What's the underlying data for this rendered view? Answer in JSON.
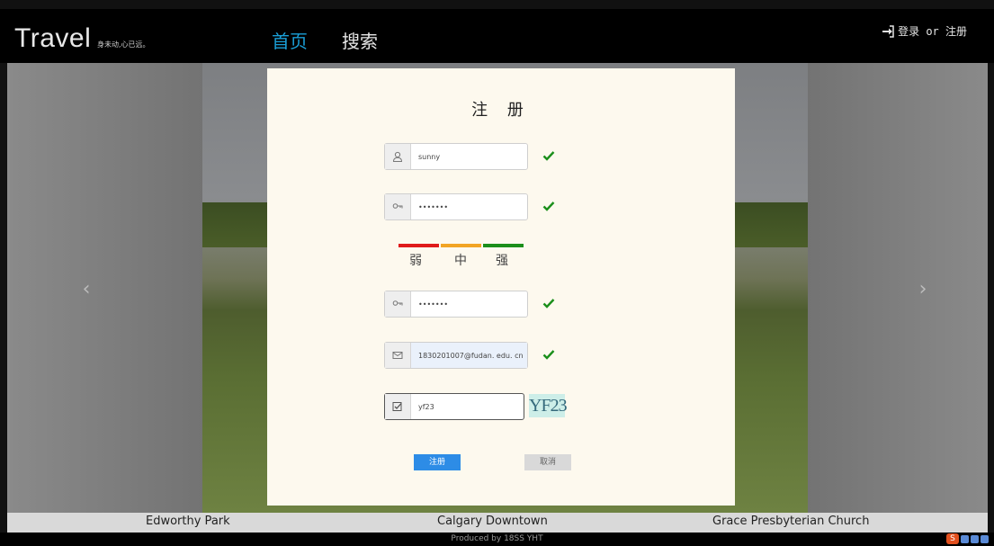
{
  "header": {
    "logo": "Travel",
    "slogan": "身未动,心已远。",
    "nav_home": "首页",
    "nav_search": "搜索",
    "login_text": "登录 or 注册"
  },
  "carousel": {
    "prev_arrow": "‹",
    "next_arrow": "›",
    "captions": [
      "Edworthy Park",
      "Calgary Downtown",
      "Grace Presbyterian Church"
    ]
  },
  "footer": {
    "text": "Produced by 18SS YHT"
  },
  "register": {
    "title": "注 册",
    "username_value": "sunny",
    "password_value": "•••••••",
    "strength_labels": [
      "弱",
      "中",
      "强"
    ],
    "confirm_value": "•••••••",
    "email_value": "1830201007@fudan. edu. cn",
    "captcha_value": "yf23",
    "captcha_image_text": "YF23",
    "submit_label": "注册",
    "cancel_label": "取消"
  },
  "colors": {
    "accent_blue": "#2d8ce6",
    "nav_active": "#1a9fd7",
    "valid_check": "#1b8f1b",
    "weak": "#e01b1b",
    "medium": "#f2a524",
    "strong": "#1b8f1b"
  }
}
